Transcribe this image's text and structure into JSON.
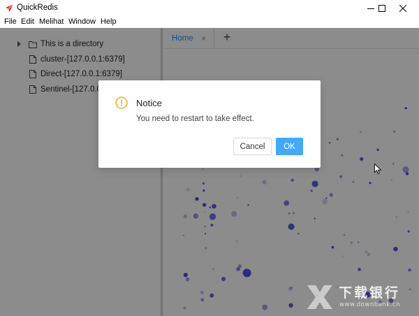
{
  "window": {
    "title": "QuickRedis",
    "accent_color": "#e8252a"
  },
  "menu": {
    "items": [
      "File",
      "Edit",
      "Melihat",
      "Window",
      "Help"
    ]
  },
  "sidebar": {
    "items": [
      {
        "label": "This is a directory",
        "icon": "folder-icon",
        "expandable": true
      },
      {
        "label": "cluster-[127.0.0.1:6379]",
        "icon": "file-icon",
        "expandable": false
      },
      {
        "label": "Direct-[127.0.0.1:6379]",
        "icon": "file-icon",
        "expandable": false
      },
      {
        "label": "Sentinel-[127.0.0.1",
        "icon": "file-icon",
        "expandable": false
      }
    ]
  },
  "tabs": {
    "items": [
      {
        "label": "Home",
        "close": "×"
      }
    ],
    "add_label": "+",
    "active_color": "#1890ff"
  },
  "dialog": {
    "title": "Notice",
    "message": "You need to restart to take effect.",
    "cancel_label": "Cancel",
    "ok_label": "OK",
    "icon": "warning-icon",
    "icon_color": "#faad14",
    "ok_color": "#40a9ff"
  },
  "watermark": {
    "main": "下载银行",
    "sub": "www.downbank.cn"
  },
  "particles_color": "#3b3bd6"
}
